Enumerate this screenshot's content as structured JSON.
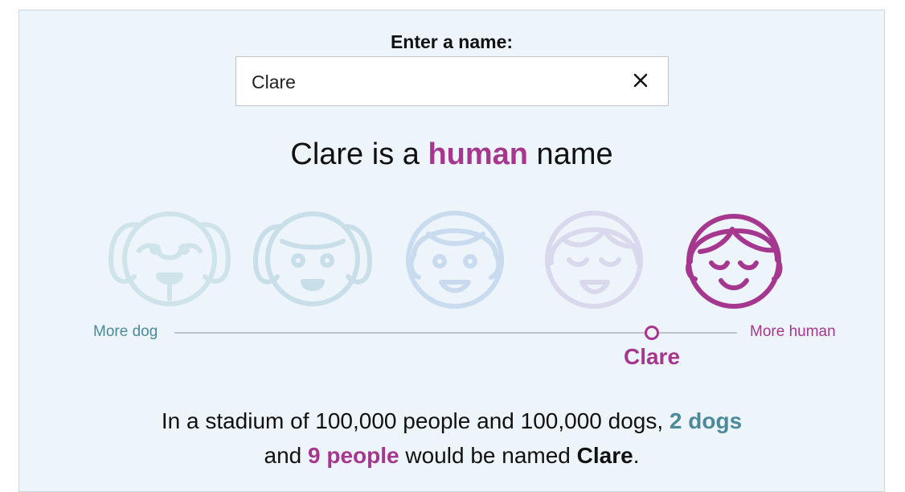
{
  "prompt": "Enter a name:",
  "search": {
    "value": "Clare",
    "clear_icon": "close-icon"
  },
  "headline": {
    "name": "Clare",
    "middle": " is a ",
    "verdict": "human",
    "tail": " name"
  },
  "scale": {
    "left_label": "More dog",
    "right_label": "More human",
    "marker_label": "Clare",
    "position_fraction": 0.85
  },
  "faces": [
    {
      "icon": "dog-face-icon",
      "color": "#cfe3ea"
    },
    {
      "icon": "dog-human-face-icon",
      "color": "#c8dfe9"
    },
    {
      "icon": "child-face-icon",
      "color": "#c9dbef"
    },
    {
      "icon": "woman-face-icon",
      "color": "#d9d8ec"
    },
    {
      "icon": "human-face-icon",
      "color": "#a5378f"
    }
  ],
  "stat": {
    "line1_prefix": "In a stadium of 100,000 people and 100,000 dogs, ",
    "dogs": "2 dogs",
    "line2_prefix": "and ",
    "people": "9 people",
    "line2_mid": " would be named ",
    "name": "Clare",
    "line2_end": "."
  },
  "colors": {
    "dog": "#4c8a9a",
    "human": "#a5378f",
    "panel": "#edf4fa"
  }
}
